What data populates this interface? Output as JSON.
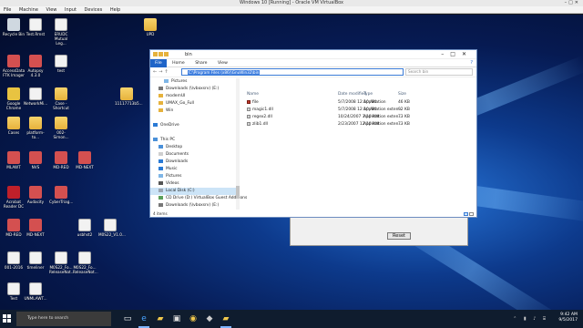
{
  "host": {
    "title": "Windows 10 [Running] - Oracle VM VirtualBox",
    "menu": [
      "File",
      "Machine",
      "View",
      "Input",
      "Devices",
      "Help"
    ]
  },
  "desktop_icons": [
    {
      "label": "Recycle Bin",
      "kind": "recycle"
    },
    {
      "label": "Test.Rmst",
      "kind": "doc"
    },
    {
      "label": "ERUDC Mutual Leg...",
      "kind": "doc"
    },
    {
      "label": "AccessData FTK Imager",
      "kind": "app"
    },
    {
      "label": "Autopsy 4.3.0",
      "kind": "app"
    },
    {
      "label": "test",
      "kind": "doc"
    },
    {
      "label": "Google Chrome",
      "kind": "chrome"
    },
    {
      "label": "NetworkMi...",
      "kind": "doc"
    },
    {
      "label": "Case - Shortcut",
      "kind": "folder"
    },
    {
      "label": "Cases",
      "kind": "folder"
    },
    {
      "label": "platform-to...",
      "kind": "folder"
    },
    {
      "label": "002-Simon...",
      "kind": "folder"
    },
    {
      "label": "MLAWT",
      "kind": "app"
    },
    {
      "label": "NVS",
      "kind": "app"
    },
    {
      "label": "MD-RED",
      "kind": "app"
    },
    {
      "label": "MD-NEXT",
      "kind": "app"
    },
    {
      "label": "Acrobat Reader DC",
      "kind": "acrobat"
    },
    {
      "label": "Audacity",
      "kind": "app"
    },
    {
      "label": "CyberTriag...",
      "kind": "app"
    },
    {
      "label": "MD-RED",
      "kind": "app"
    },
    {
      "label": "MD-NEXT",
      "kind": "app"
    },
    {
      "label": "usbhst2",
      "kind": "doc"
    },
    {
      "label": "M0S22_V1.0...",
      "kind": "doc"
    },
    {
      "label": "001-2016",
      "kind": "doc"
    },
    {
      "label": "timeliner",
      "kind": "doc"
    },
    {
      "label": "M0S22_Fo... ReleaseNot...",
      "kind": "doc"
    },
    {
      "label": "M0S22_Fo... ReleaseNot...",
      "kind": "doc"
    },
    {
      "label": "Test",
      "kind": "doc"
    },
    {
      "label": "UNMLAWT...",
      "kind": "doc"
    },
    {
      "label": "UPD",
      "kind": "folder"
    },
    {
      "label": "11117713b5...",
      "kind": "folder"
    }
  ],
  "bg_dialog": {
    "reset_label": "Reset"
  },
  "explorer": {
    "title": "bin",
    "ribbon_tabs": [
      "File",
      "Home",
      "Share",
      "View"
    ],
    "address_path": "C:\\Program Files (x86)\\GnuWin32\\bin",
    "search_placeholder": "Search bin",
    "nav_items": [
      {
        "label": "Pictures",
        "indent": 2,
        "icon": "#7fb6e6"
      },
      {
        "label": "Downloads (\\\\vboxsrv) (E:)",
        "indent": 1,
        "icon": "#777777"
      },
      {
        "label": "modernUI",
        "indent": 1,
        "icon": "#e6b23c"
      },
      {
        "label": "UMAX_Go_Full",
        "indent": 1,
        "icon": "#e6b23c"
      },
      {
        "label": "Win",
        "indent": 1,
        "icon": "#e6b23c"
      },
      {
        "label": "",
        "indent": 0,
        "icon": ""
      },
      {
        "label": "OneDrive",
        "indent": 0,
        "icon": "#2a7ad5"
      },
      {
        "label": "",
        "indent": 0,
        "icon": ""
      },
      {
        "label": "This PC",
        "indent": 0,
        "icon": "#4a90d9"
      },
      {
        "label": "Desktop",
        "indent": 1,
        "icon": "#4a90d9"
      },
      {
        "label": "Documents",
        "indent": 1,
        "icon": "#cfcfcf"
      },
      {
        "label": "Downloads",
        "indent": 1,
        "icon": "#2a7ad5"
      },
      {
        "label": "Music",
        "indent": 1,
        "icon": "#2a7ad5"
      },
      {
        "label": "Pictures",
        "indent": 1,
        "icon": "#7fb6e6"
      },
      {
        "label": "Videos",
        "indent": 1,
        "icon": "#555555"
      },
      {
        "label": "Local Disk (C:)",
        "indent": 1,
        "icon": "#9aa4b0",
        "selected": true
      },
      {
        "label": "CD Drive (D:) VirtualBox Guest Additions",
        "indent": 1,
        "icon": "#5aa05a"
      },
      {
        "label": "Downloads (\\\\vboxsrv) (E:)",
        "indent": 1,
        "icon": "#777777"
      }
    ],
    "columns": {
      "name": "Name",
      "date": "Date modified",
      "type": "Type",
      "size": "Size"
    },
    "files": [
      {
        "name": "file",
        "date": "5/7/2008 12:10 AM",
        "type": "Application",
        "size": "46 KB",
        "icon": "exe"
      },
      {
        "name": "magic1.dll",
        "date": "5/7/2008 12:10 AM",
        "type": "Application exten...",
        "size": "92 KB",
        "icon": "dll"
      },
      {
        "name": "regex2.dll",
        "date": "10/24/2007 3:10 AM",
        "type": "Application exten...",
        "size": "73 KB",
        "icon": "dll"
      },
      {
        "name": "zlib1.dll",
        "date": "2/23/2007 12:10 AM",
        "type": "Application exten...",
        "size": "73 KB",
        "icon": "dll"
      }
    ],
    "status": "4 items"
  },
  "taskbar": {
    "search_placeholder": "Type here to search",
    "time": "9:42 AM",
    "date": "9/5/2017"
  }
}
